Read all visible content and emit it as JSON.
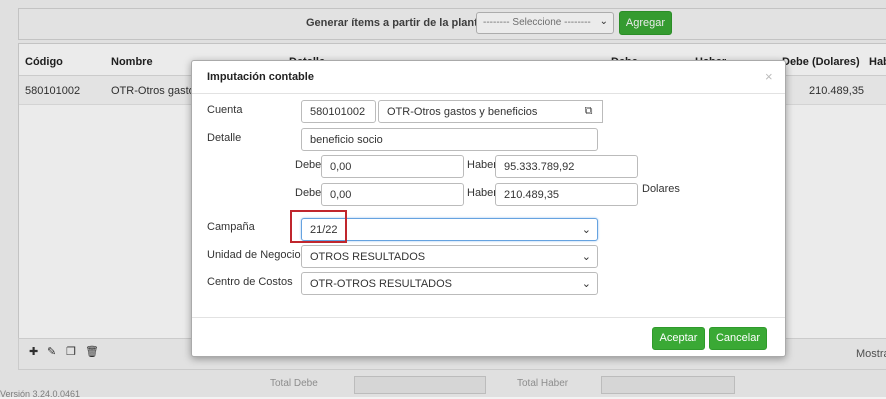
{
  "toolbar": {
    "generate_label": "Generar ítems a partir de la plantilla",
    "template_select_value": "-------- Seleccione --------",
    "add_button": "Agregar"
  },
  "grid": {
    "columns": [
      "Código",
      "Nombre",
      "Detalle",
      "Debe",
      "Haber",
      "Debe (Dolares)",
      "Hab"
    ],
    "row": {
      "codigo": "580101002",
      "nombre": "OTR-Otros gastos",
      "debe_dolares": "210.489,35"
    }
  },
  "footer": {
    "mostrar": "Mostra",
    "total_debe": "Total Debe",
    "total_haber": "Total Haber",
    "version": "Versión 3.24.0.0461"
  },
  "modal": {
    "title": "Imputación contable",
    "close": "×",
    "cuenta_label": "Cuenta",
    "cuenta_codigo": "580101002",
    "cuenta_nombre": "OTR-Otros gastos y beneficios",
    "detalle_label": "Detalle",
    "detalle_value": "beneficio socio",
    "debe_label": "Debe",
    "haber_label": "Haber",
    "debe_value": "0,00",
    "haber_value": "95.333.789,92",
    "debe_usd_value": "0,00",
    "haber_usd_value": "210.489,35",
    "dolares_label": "Dolares",
    "campana_label": "Campaña",
    "campana_value": "21/22",
    "unidad_label": "Unidad de Negocio",
    "unidad_value": "OTROS RESULTADOS",
    "centro_label": "Centro de Costos",
    "centro_value": "OTR-OTROS RESULTADOS",
    "accept_button": "Aceptar",
    "cancel_button": "Cancelar"
  },
  "colors": {
    "accent_green": "#3aa935",
    "highlight_red": "#c0262d",
    "focus_blue": "#66a3e0"
  }
}
